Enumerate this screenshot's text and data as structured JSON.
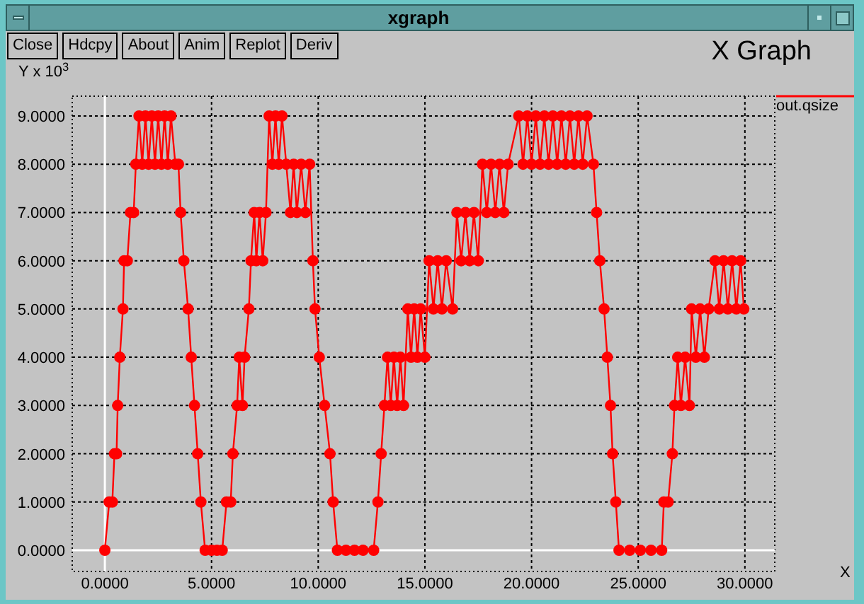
{
  "window": {
    "title": "xgraph"
  },
  "buttons": [
    {
      "label": "Close"
    },
    {
      "label": "Hdcpy"
    },
    {
      "label": "About"
    },
    {
      "label": "Anim"
    },
    {
      "label": "Replot"
    },
    {
      "label": "Deriv"
    }
  ],
  "graph": {
    "chart_data": {
      "type": "line",
      "title": "X Graph",
      "xlabel": "X",
      "ylabel": "Y x 10$^{3}$",
      "x": [
        0,
        0.2,
        0.35,
        0.45,
        0.55,
        0.6,
        0.7,
        0.85,
        0.9,
        1.05,
        1.2,
        1.35,
        1.45,
        1.6,
        1.75,
        1.9,
        2.05,
        2.2,
        2.35,
        2.5,
        2.65,
        2.8,
        2.95,
        3.1,
        3.3,
        3.45,
        3.55,
        3.7,
        3.9,
        4.05,
        4.2,
        4.35,
        4.5,
        4.7,
        5.0,
        5.25,
        5.5,
        5.7,
        5.9,
        6.0,
        6.2,
        6.3,
        6.45,
        6.55,
        6.75,
        6.85,
        7.0,
        7.1,
        7.25,
        7.4,
        7.55,
        7.7,
        7.85,
        8.0,
        8.15,
        8.3,
        8.5,
        8.7,
        8.85,
        9.0,
        9.2,
        9.4,
        9.6,
        9.75,
        9.85,
        10.05,
        10.3,
        10.55,
        10.7,
        10.9,
        11.3,
        11.7,
        12.1,
        12.6,
        12.8,
        12.95,
        13.1,
        13.25,
        13.4,
        13.55,
        13.7,
        13.85,
        14.0,
        14.2,
        14.35,
        14.5,
        14.65,
        14.8,
        15.0,
        15.2,
        15.4,
        15.6,
        15.8,
        16.0,
        16.3,
        16.5,
        16.7,
        16.9,
        17.1,
        17.3,
        17.5,
        17.7,
        17.9,
        18.1,
        18.3,
        18.5,
        18.7,
        18.9,
        19.4,
        19.6,
        19.8,
        20.0,
        20.2,
        20.4,
        20.6,
        20.8,
        21.0,
        21.2,
        21.4,
        21.6,
        21.8,
        22.0,
        22.2,
        22.4,
        22.6,
        22.9,
        23.05,
        23.2,
        23.4,
        23.55,
        23.7,
        23.8,
        23.95,
        24.1,
        24.6,
        25.1,
        25.6,
        26.1,
        26.2,
        26.4,
        26.6,
        26.7,
        26.85,
        27.0,
        27.2,
        27.4,
        27.5,
        27.7,
        27.9,
        28.1,
        28.3,
        28.6,
        28.8,
        29.0,
        29.2,
        29.4,
        29.6,
        29.8,
        29.95
      ],
      "series": [
        {
          "name": "out.qsize",
          "color": "#ff0000",
          "marker": "circle",
          "values": [
            0,
            1,
            1,
            2,
            2,
            3,
            4,
            5,
            6,
            6,
            7,
            7,
            8,
            9,
            8,
            9,
            8,
            9,
            8,
            9,
            8,
            9,
            8,
            9,
            8,
            8,
            7,
            6,
            5,
            4,
            3,
            2,
            1,
            0,
            0,
            0,
            0,
            1,
            1,
            2,
            3,
            4,
            3,
            4,
            5,
            6,
            7,
            6,
            7,
            6,
            7,
            9,
            8,
            9,
            8,
            9,
            8,
            7,
            8,
            7,
            8,
            7,
            8,
            6,
            5,
            4,
            3,
            2,
            1,
            0,
            0,
            0,
            0,
            0,
            1,
            2,
            3,
            4,
            3,
            4,
            3,
            4,
            3,
            5,
            4,
            5,
            4,
            5,
            4,
            6,
            5,
            6,
            5,
            6,
            5,
            7,
            6,
            7,
            6,
            7,
            6,
            8,
            7,
            8,
            7,
            8,
            7,
            8,
            9,
            8,
            9,
            8,
            9,
            8,
            9,
            8,
            9,
            8,
            9,
            8,
            9,
            8,
            9,
            8,
            9,
            8,
            7,
            6,
            5,
            4,
            3,
            2,
            1,
            0,
            0,
            0,
            0,
            0,
            1,
            1,
            2,
            3,
            4,
            3,
            4,
            3,
            5,
            4,
            5,
            4,
            5,
            6,
            5,
            6,
            5,
            6,
            5,
            6,
            5
          ]
        }
      ],
      "grid": true,
      "xlim": [
        -1.53,
        31.4
      ],
      "ylim": [
        -0.44,
        9.41
      ],
      "xticks": [
        {
          "value": 0,
          "label": "0.0000"
        },
        {
          "value": 5,
          "label": "5.0000"
        },
        {
          "value": 10,
          "label": "10.0000"
        },
        {
          "value": 15,
          "label": "15.0000"
        },
        {
          "value": 20,
          "label": "20.0000"
        },
        {
          "value": 25,
          "label": "25.0000"
        },
        {
          "value": 30,
          "label": "30.0000"
        }
      ],
      "yticks": [
        {
          "value": 0,
          "label": "0.0000"
        },
        {
          "value": 1,
          "label": "1.0000"
        },
        {
          "value": 2,
          "label": "2.0000"
        },
        {
          "value": 3,
          "label": "3.0000"
        },
        {
          "value": 4,
          "label": "4.0000"
        },
        {
          "value": 5,
          "label": "5.0000"
        },
        {
          "value": 6,
          "label": "6.0000"
        },
        {
          "value": 7,
          "label": "7.0000"
        },
        {
          "value": 8,
          "label": "8.0000"
        },
        {
          "value": 9,
          "label": "9.0000"
        }
      ]
    }
  }
}
